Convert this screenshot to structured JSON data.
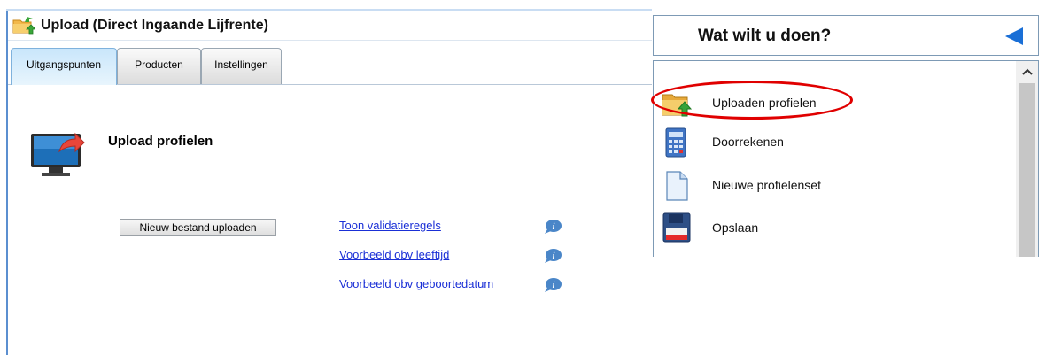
{
  "left": {
    "title": "Upload (Direct Ingaande Lijfrente)",
    "tabs": [
      {
        "label": "Uitgangspunten",
        "active": true
      },
      {
        "label": "Producten",
        "active": false
      },
      {
        "label": "Instellingen",
        "active": false
      }
    ],
    "section_title": "Upload profielen",
    "upload_button": "Nieuw bestand uploaden",
    "links": [
      {
        "label": "Toon validatieregels",
        "icon": "info-icon"
      },
      {
        "label": "Voorbeeld obv leeftijd",
        "icon": "info-icon"
      },
      {
        "label": "Voorbeeld obv geboortedatum",
        "icon": "info-icon"
      }
    ]
  },
  "right": {
    "title": "Wat wilt u doen?",
    "items": [
      {
        "label": "Uploaden profielen",
        "icon": "folder-upload-icon",
        "highlighted": true
      },
      {
        "label": "Doorrekenen",
        "icon": "calculator-icon"
      },
      {
        "label": "Nieuwe profielenset",
        "icon": "new-document-icon"
      },
      {
        "label": "Opslaan",
        "icon": "floppy-disk-icon"
      }
    ]
  },
  "colors": {
    "accent_blue": "#1a6fd6",
    "link": "#1a2fd6",
    "highlight": "#e00000",
    "tab_active": "#c9e6fb"
  }
}
